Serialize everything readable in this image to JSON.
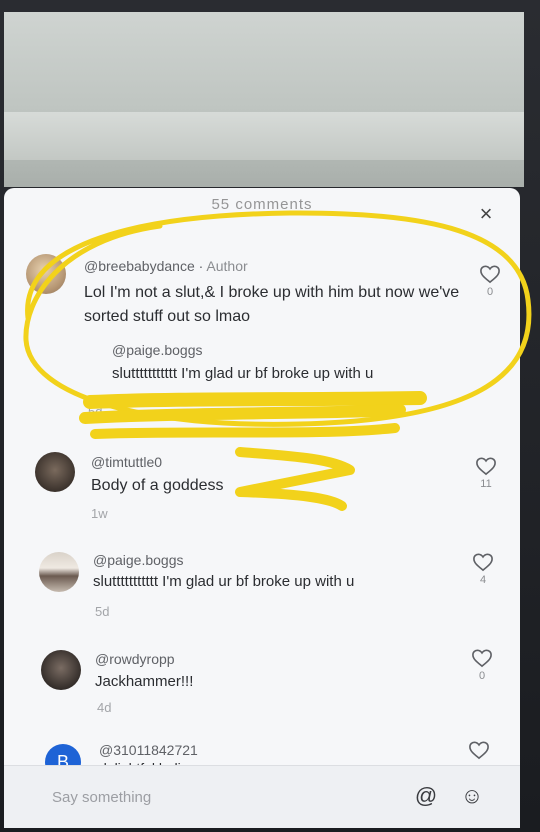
{
  "sheet": {
    "title": "55 comments",
    "close_icon": "close-icon"
  },
  "comments": [
    {
      "username": "@breebabydance",
      "author_tag": "Author",
      "separator": " · ",
      "text": "Lol I'm not a slut,& I broke up with him but now we've sorted stuff out so lmao",
      "time": "5d",
      "likes": "0",
      "reply_to": {
        "username": "@paige.boggs",
        "text": "sluttttttttttt I'm glad ur bf broke up with u"
      }
    },
    {
      "username": "@timtuttle0",
      "text": "Body of a goddess",
      "time": "1w",
      "likes": "11"
    },
    {
      "username": "@paige.boggs",
      "text": "sluttttttttttt I'm glad ur bf broke up with u",
      "time": "5d",
      "likes": "4"
    },
    {
      "username": "@rowdyropp",
      "text": "Jackhammer!!!",
      "time": "4d",
      "likes": "0"
    },
    {
      "username": "@31011842721",
      "avatar_letter": "B",
      "text": "delightful ladies",
      "likes": ""
    }
  ],
  "input": {
    "placeholder": "Say something",
    "mention_icon": "at-icon",
    "emoji_icon": "emoji-icon"
  },
  "colors": {
    "highlight": "#f2d21b",
    "avatar_b": "#1e63d6"
  }
}
